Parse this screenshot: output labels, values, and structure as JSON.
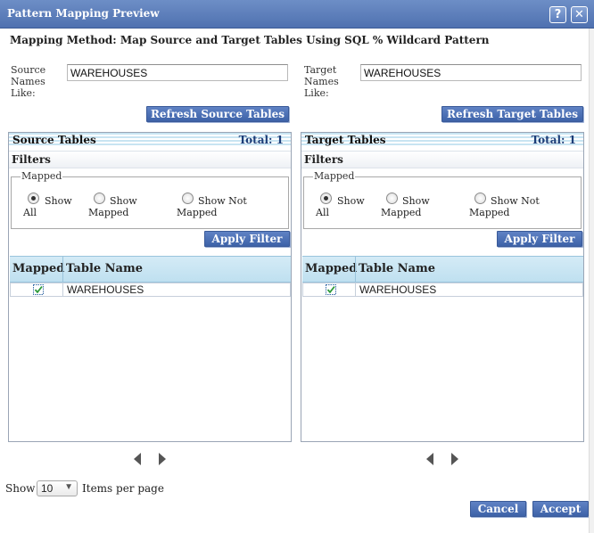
{
  "window": {
    "title": "Pattern Mapping Preview",
    "help_icon": "question-icon",
    "close_icon": "close-icon"
  },
  "mapping_method": "Mapping Method: Map Source and Target Tables Using SQL % Wildcard Pattern",
  "source": {
    "label_line1": "Source",
    "label_line2": "Names",
    "label_line3": "Like:",
    "value": "WAREHOUSES",
    "refresh_button": "Refresh Source Tables",
    "panel_title": "Source Tables",
    "total": "Total: 1",
    "filters_title": "Filters",
    "filter_group": "Mapped",
    "radio_all_1": "Show",
    "radio_all_2": "All",
    "radio_mapped_1": "Show",
    "radio_mapped_2": "Mapped",
    "radio_notmapped_1": "Show Not",
    "radio_notmapped_2": "Mapped",
    "apply_filter": "Apply Filter",
    "col_mapped": "Mapped",
    "col_table": "Table Name",
    "rows": [
      {
        "mapped": true,
        "table": "WAREHOUSES"
      }
    ]
  },
  "target": {
    "label_line1": "Target",
    "label_line2": "Names",
    "label_line3": "Like:",
    "value": "WAREHOUSES",
    "refresh_button": "Refresh Target Tables",
    "panel_title": "Target Tables",
    "total": "Total: 1",
    "filters_title": "Filters",
    "filter_group": "Mapped",
    "radio_all_1": "Show",
    "radio_all_2": "All",
    "radio_mapped_1": "Show",
    "radio_mapped_2": "Mapped",
    "radio_notmapped_1": "Show Not",
    "radio_notmapped_2": "Mapped",
    "apply_filter": "Apply Filter",
    "col_mapped": "Mapped",
    "col_table": "Table Name",
    "rows": [
      {
        "mapped": true,
        "table": "WAREHOUSES"
      }
    ]
  },
  "pager": {
    "show_label": "Show",
    "page_size": "10",
    "items_label": "Items per page"
  },
  "footer": {
    "cancel": "Cancel",
    "accept": "Accept"
  },
  "colors": {
    "title_bar": "#4f71b0",
    "button": "#3d62a8",
    "grid_header": "#c9e6f4"
  }
}
